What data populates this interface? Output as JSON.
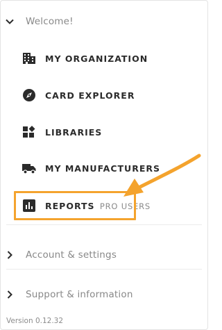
{
  "welcome": {
    "label": "Welcome!",
    "icon": "chevron-down-icon"
  },
  "menu": {
    "items": [
      {
        "label": "MY ORGANIZATION",
        "icon": "building-icon"
      },
      {
        "label": "CARD EXPLORER",
        "icon": "compass-icon"
      },
      {
        "label": "LIBRARIES",
        "icon": "library-blocks-icon"
      },
      {
        "label": "MY MANUFACTURERS",
        "icon": "truck-icon"
      },
      {
        "label": "REPORTS",
        "badge": "PRO USERS",
        "icon": "bar-chart-icon"
      }
    ]
  },
  "sections": {
    "account": {
      "label": "Account & settings",
      "icon": "chevron-right-icon"
    },
    "support": {
      "label": "Support & information",
      "icon": "chevron-right-icon"
    }
  },
  "footer": {
    "version": "Version 0.12.32"
  },
  "colors": {
    "highlight": "#f4a32d",
    "icon": "#2b2b2b",
    "muted_text": "#888888"
  }
}
